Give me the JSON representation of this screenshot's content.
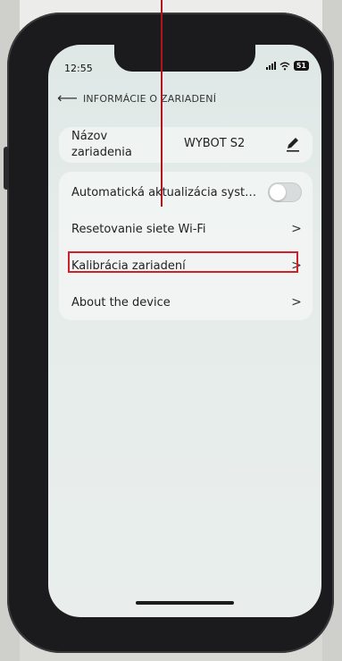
{
  "status_bar": {
    "time": "12:55",
    "battery": "51"
  },
  "header": {
    "title": "INFORMÁCIE O ZARIADENÍ"
  },
  "device_name": {
    "label": "Názov zariadenia",
    "value": "WYBOT S2"
  },
  "settings": {
    "items": [
      {
        "label": "Automatická aktualizácia syst…",
        "control": "toggle",
        "toggle_on": false
      },
      {
        "label": "Resetovanie siete Wi-Fi",
        "control": "chevron"
      },
      {
        "label": "Kalibrácia zariadení",
        "control": "chevron",
        "highlighted": true
      },
      {
        "label": "About the device",
        "control": "chevron"
      }
    ]
  },
  "colors": {
    "highlight": "#d0202a",
    "phone_frame": "#1b1b1d"
  },
  "icons": {
    "back": "back-arrow-icon",
    "edit": "pencil-icon",
    "chevron": "chevron-right-icon"
  }
}
